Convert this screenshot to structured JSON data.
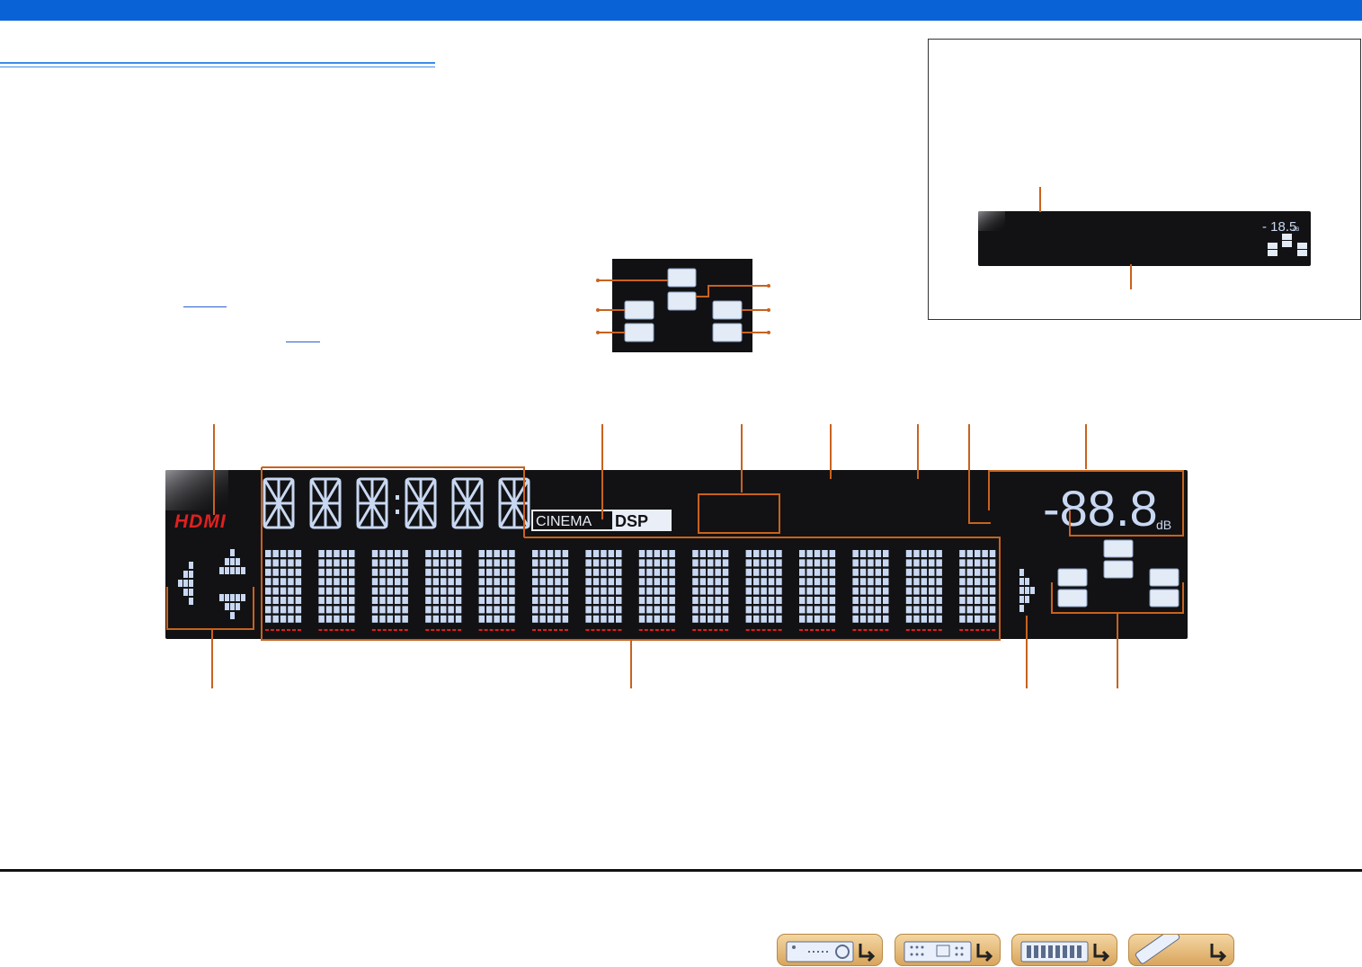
{
  "display": {
    "hdmi_indicator": "HDMI",
    "cinema_dsp_prefix": "CINEMA",
    "cinema_dsp_suffix": "DSP",
    "volume_readout": "-88.8",
    "volume_unit": "dB"
  },
  "inset": {
    "volume_readout": "- 18.5",
    "volume_unit": "dB"
  },
  "colors": {
    "header_bar": "#0a63d6",
    "callout": "#c8621e",
    "display_bg": "#121214",
    "segment": "#c9d8f2",
    "hdmi": "#e02020",
    "nav_button": "#e9bd7d"
  },
  "nav": {
    "buttons": [
      {
        "icon": "front-panel-icon"
      },
      {
        "icon": "rear-panel-icon"
      },
      {
        "icon": "front-display-icon"
      },
      {
        "icon": "remote-control-icon"
      }
    ]
  }
}
